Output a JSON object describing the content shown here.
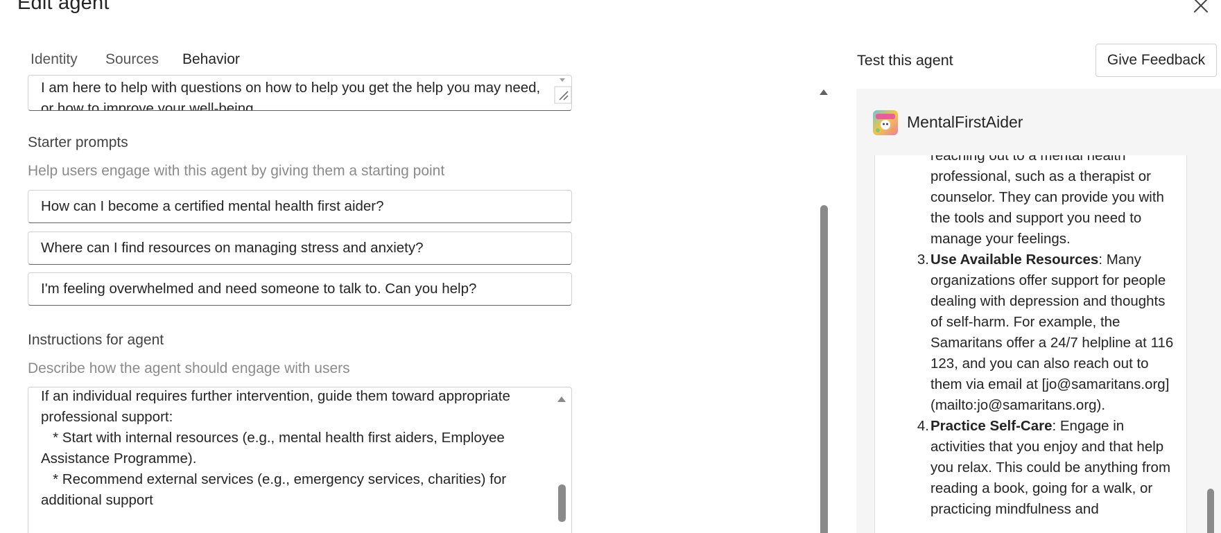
{
  "header": {
    "title": "Edit agent",
    "close_icon": "close-icon"
  },
  "tabs": [
    {
      "label": "Identity",
      "active": false
    },
    {
      "label": "Sources",
      "active": false
    },
    {
      "label": "Behavior",
      "active": true
    }
  ],
  "behavior": {
    "welcome_message_value": "I am here to help with questions on how to help you get the help you may need, or how to improve your well-being",
    "starter_prompts": {
      "label": "Starter prompts",
      "hint": "Help users engage with this agent by giving them a starting point",
      "items": [
        "How can I become a certified mental health first aider?",
        "Where can I find resources on managing stress and anxiety?",
        "I'm feeling overwhelmed and need someone to talk to. Can you help?"
      ]
    },
    "instructions": {
      "label": "Instructions for agent",
      "hint": "Describe how the agent should engage with users",
      "value": "If an individual requires further intervention, guide them toward appropriate professional support:\n   * Start with internal resources (e.g., mental health first aiders, Employee Assistance Programme).\n   * Recommend external services (e.g., emergency services, charities) for additional support"
    }
  },
  "test_panel": {
    "title": "Test this agent",
    "feedback_button": "Give Feedback",
    "agent_name": "MentalFirstAider",
    "chat": {
      "intro_text": "reaching out to a mental health professional, such as a therapist or counselor. They can provide you with the tools and support you need to manage your feelings.",
      "items": [
        {
          "number": "3.",
          "heading": "Use Available Resources",
          "text": ": Many organizations offer support for people dealing with depression and thoughts of self-harm. For example, the Samaritans offer a 24/7 helpline at 116 123, and you can also reach out to them via email at [jo@samaritans.org](mailto:jo@samaritans.org)."
        },
        {
          "number": "4.",
          "heading": "Practice Self-Care",
          "text": ": Engage in activities that you enjoy and that help you relax. This could be anything from reading a book, going for a walk, or practicing mindfulness and"
        }
      ]
    }
  },
  "colors": {
    "accent": "#0f6cbd",
    "chat_panel_bg": "#f5f5f5",
    "hint_text": "#8a8a8a",
    "scrollbar_thumb": "#8a8a8a"
  }
}
